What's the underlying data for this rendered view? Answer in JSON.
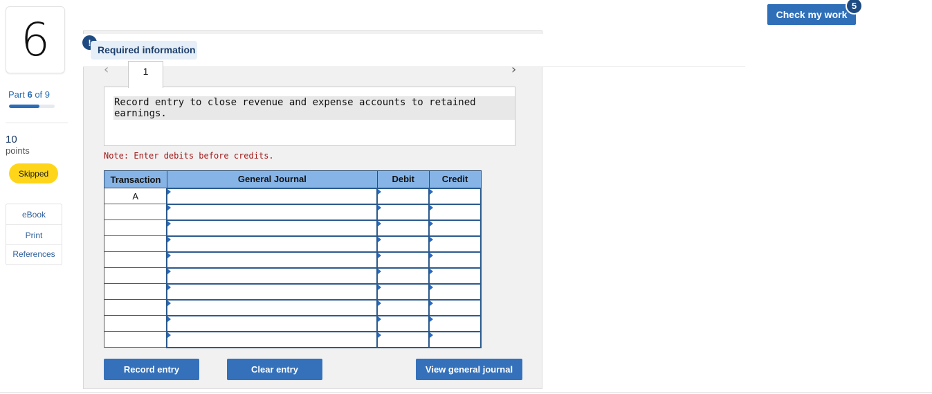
{
  "question": {
    "number": "6"
  },
  "part": {
    "prefix": "Part ",
    "current": "6",
    "separator": " of ",
    "total": "9",
    "progress_fraction": 0.67
  },
  "points": {
    "value": "10",
    "label": "points"
  },
  "status": {
    "label": "Skipped",
    "color": "#ffd51a"
  },
  "resources": [
    "eBook",
    "Print",
    "References"
  ],
  "header": {
    "check_label": "Check my work",
    "check_count": "5"
  },
  "required": {
    "icon": "!",
    "label": "Required information"
  },
  "tabs": [
    {
      "label": "1"
    }
  ],
  "instruction": "Record entry to close revenue and expense accounts to retained earnings.",
  "note": "Note: Enter debits before credits.",
  "journal": {
    "columns": [
      "Transaction",
      "General Journal",
      "Debit",
      "Credit"
    ],
    "rows": [
      {
        "transaction": "A",
        "account": "",
        "debit": "",
        "credit": ""
      },
      {
        "transaction": "",
        "account": "",
        "debit": "",
        "credit": ""
      },
      {
        "transaction": "",
        "account": "",
        "debit": "",
        "credit": ""
      },
      {
        "transaction": "",
        "account": "",
        "debit": "",
        "credit": ""
      },
      {
        "transaction": "",
        "account": "",
        "debit": "",
        "credit": ""
      },
      {
        "transaction": "",
        "account": "",
        "debit": "",
        "credit": ""
      },
      {
        "transaction": "",
        "account": "",
        "debit": "",
        "credit": ""
      },
      {
        "transaction": "",
        "account": "",
        "debit": "",
        "credit": ""
      },
      {
        "transaction": "",
        "account": "",
        "debit": "",
        "credit": ""
      },
      {
        "transaction": "",
        "account": "",
        "debit": "",
        "credit": ""
      }
    ]
  },
  "buttons": {
    "record": "Record entry",
    "clear": "Clear entry",
    "view": "View general journal"
  },
  "colors": {
    "accent": "#2f6fb8",
    "header_fill": "#86b4e6",
    "note": "#a31515"
  }
}
